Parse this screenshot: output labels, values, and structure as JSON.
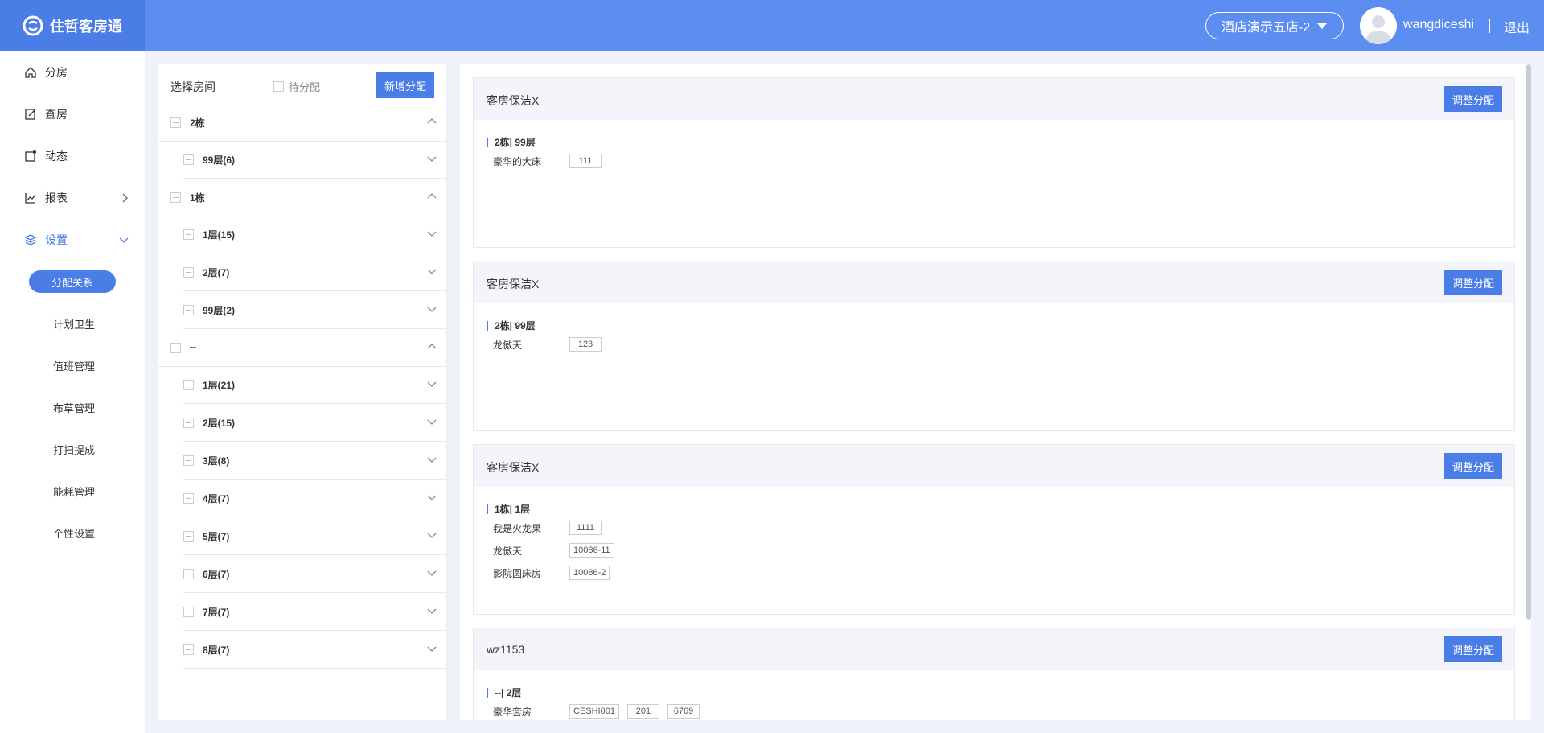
{
  "header": {
    "brand": "住哲客房通",
    "hotel": "酒店演示五店-2",
    "username": "wangdiceshi",
    "logout": "退出"
  },
  "sidebar": {
    "items": [
      {
        "label": "分房",
        "icon": "home-icon"
      },
      {
        "label": "查房",
        "icon": "edit-icon"
      },
      {
        "label": "动态",
        "icon": "activity-icon"
      },
      {
        "label": "报表",
        "icon": "chart-icon"
      },
      {
        "label": "设置",
        "icon": "layers-icon"
      }
    ],
    "sub_items": [
      "分配关系",
      "计划卫生",
      "值班管理",
      "布草管理",
      "打扫提成",
      "能耗管理",
      "个性设置"
    ]
  },
  "left_panel": {
    "title": "选择房间",
    "pending_label": "待分配",
    "add_button": "新增分配",
    "tree": [
      {
        "label": "2栋",
        "level": 0,
        "expanded": true
      },
      {
        "label": "99层(6)",
        "level": 1
      },
      {
        "label": "1栋",
        "level": 0,
        "expanded": true
      },
      {
        "label": "1层(15)",
        "level": 1
      },
      {
        "label": "2层(7)",
        "level": 1
      },
      {
        "label": "99层(2)",
        "level": 1
      },
      {
        "label": "--",
        "level": 0,
        "expanded": true
      },
      {
        "label": "1层(21)",
        "level": 1
      },
      {
        "label": "2层(15)",
        "level": 1
      },
      {
        "label": "3层(8)",
        "level": 1
      },
      {
        "label": "4层(7)",
        "level": 1
      },
      {
        "label": "5层(7)",
        "level": 1
      },
      {
        "label": "6层(7)",
        "level": 1
      },
      {
        "label": "7层(7)",
        "level": 1
      },
      {
        "label": "8层(7)",
        "level": 1
      }
    ]
  },
  "cards": [
    {
      "title": "客房保洁X",
      "button": "调整分配",
      "group": "2栋| 99层",
      "rooms": [
        {
          "name": "豪华的大床",
          "numbers": [
            "111"
          ]
        }
      ]
    },
    {
      "title": "客房保洁X",
      "button": "调整分配",
      "group": "2栋| 99层",
      "rooms": [
        {
          "name": "龙傲天",
          "numbers": [
            "123"
          ]
        }
      ]
    },
    {
      "title": "客房保洁X",
      "button": "调整分配",
      "group": "1栋| 1层",
      "rooms": [
        {
          "name": "我是火龙果",
          "numbers": [
            "1111"
          ]
        },
        {
          "name": "龙傲天",
          "numbers": [
            "10086-11"
          ]
        },
        {
          "name": "影院圆床房",
          "numbers": [
            "10086-2"
          ]
        }
      ]
    },
    {
      "title": "wz1153",
      "button": "调整分配",
      "group": "--| 2层",
      "rooms": [
        {
          "name": "豪华套房",
          "numbers": [
            "CESHI001",
            "201",
            "6769"
          ]
        }
      ]
    }
  ]
}
